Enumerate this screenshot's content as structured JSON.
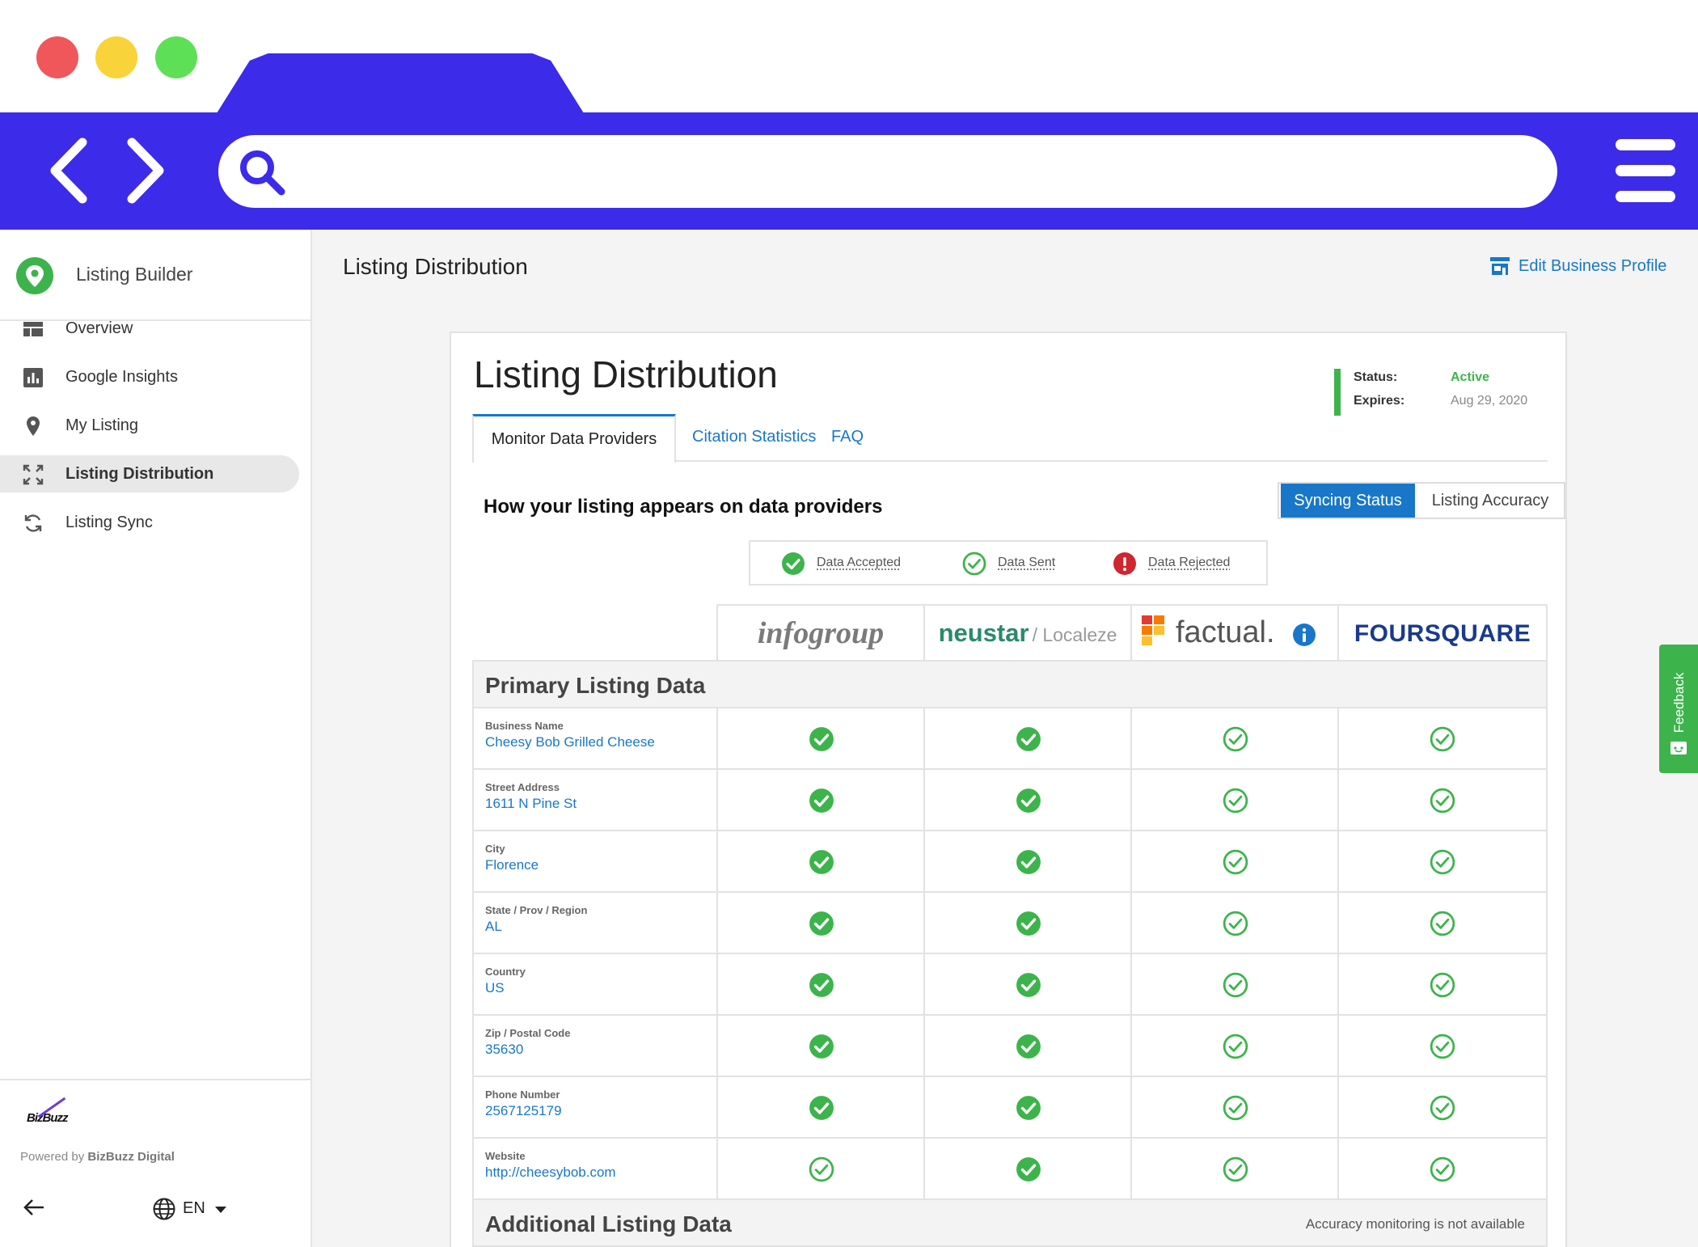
{
  "sidebar": {
    "title": "Listing Builder",
    "items": [
      {
        "label": "Overview",
        "icon": "dashboard-icon",
        "active": false
      },
      {
        "label": "Google Insights",
        "icon": "bar-chart-icon",
        "active": false
      },
      {
        "label": "My Listing",
        "icon": "map-pin-icon",
        "active": false
      },
      {
        "label": "Listing Distribution",
        "icon": "expand-icon",
        "active": true
      },
      {
        "label": "Listing Sync",
        "icon": "sync-icon",
        "active": false
      }
    ],
    "brand_logo_text": "BizBuzz",
    "powered_prefix": "Powered by ",
    "powered_brand": "BizBuzz Digital",
    "language": "EN"
  },
  "header": {
    "title": "Listing Distribution",
    "edit_profile_label": "Edit Business Profile"
  },
  "card": {
    "title": "Listing Distribution",
    "status_label": "Status:",
    "status_value": "Active",
    "expires_label": "Expires:",
    "expires_value": "Aug 29, 2020",
    "tabs": [
      "Monitor Data Providers",
      "Citation Statistics",
      "FAQ"
    ],
    "heading": "How your listing appears on data providers",
    "toggle": [
      "Syncing Status",
      "Listing Accuracy"
    ],
    "legend": [
      "Data Accepted",
      "Data Sent",
      "Data Rejected"
    ],
    "providers": [
      "infogroup",
      "neustar",
      "/ Localeze",
      "factual.",
      "FOURSQUARE"
    ],
    "group_primary": "Primary Listing Data",
    "group_additional": "Additional Listing Data",
    "additional_note": "Accuracy monitoring is not available",
    "rows": [
      {
        "label": "Business Name",
        "value": "Cheesy Bob Grilled Cheese",
        "status": [
          "accepted",
          "accepted",
          "sent",
          "sent"
        ]
      },
      {
        "label": "Street Address",
        "value": "1611 N Pine St",
        "status": [
          "accepted",
          "accepted",
          "sent",
          "sent"
        ]
      },
      {
        "label": "City",
        "value": "Florence",
        "status": [
          "accepted",
          "accepted",
          "sent",
          "sent"
        ]
      },
      {
        "label": "State / Prov / Region",
        "value": "AL",
        "status": [
          "accepted",
          "accepted",
          "sent",
          "sent"
        ]
      },
      {
        "label": "Country",
        "value": "US",
        "status": [
          "accepted",
          "accepted",
          "sent",
          "sent"
        ]
      },
      {
        "label": "Zip / Postal Code",
        "value": "35630",
        "status": [
          "accepted",
          "accepted",
          "sent",
          "sent"
        ]
      },
      {
        "label": "Phone Number",
        "value": "2567125179",
        "status": [
          "accepted",
          "accepted",
          "sent",
          "sent"
        ]
      },
      {
        "label": "Website",
        "value": "http://cheesybob.com",
        "status": [
          "sent",
          "accepted",
          "sent",
          "sent"
        ]
      }
    ]
  },
  "feedback_label": "Feedback",
  "colors": {
    "brand_blue": "#3d2bea",
    "link_blue": "#1877c9",
    "green": "#3cb44b",
    "red": "#d0262f"
  }
}
